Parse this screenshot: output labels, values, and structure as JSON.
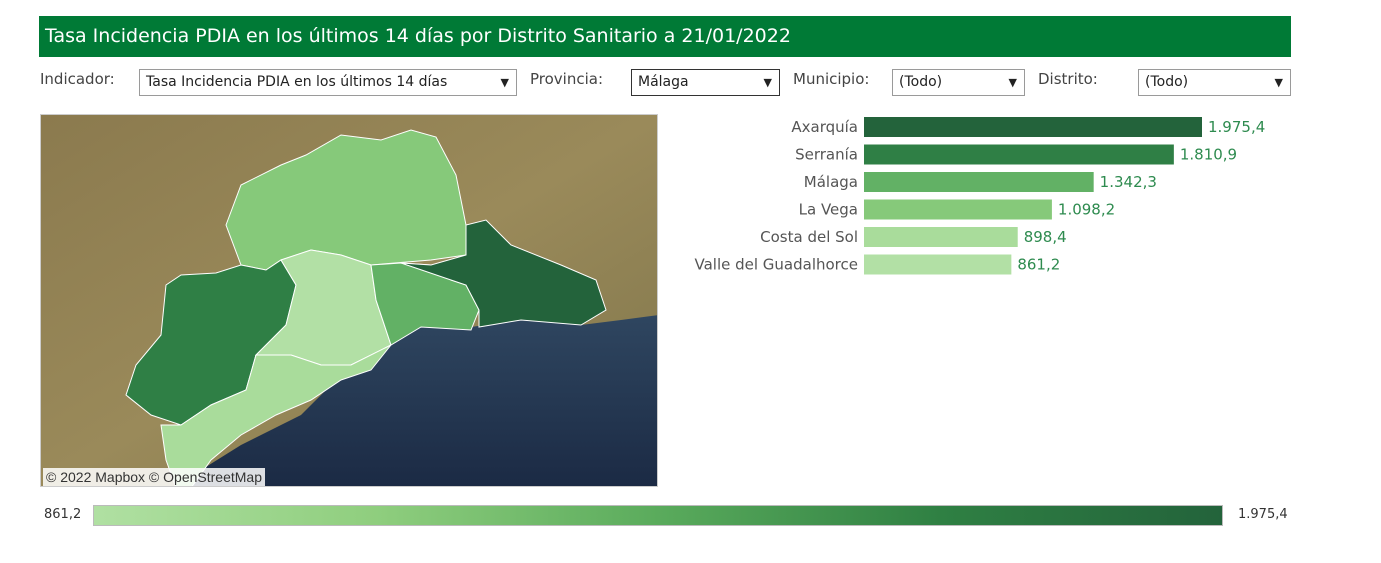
{
  "header": {
    "title": "Tasa Incidencia PDIA en los últimos 14 días por Distrito Sanitario a 21/01/2022"
  },
  "filters": {
    "indicador": {
      "label": "Indicador:",
      "value": "Tasa Incidencia PDIA en los últimos 14 días"
    },
    "provincia": {
      "label": "Provincia:",
      "value": "Málaga"
    },
    "municipio": {
      "label": "Municipio:",
      "value": "(Todo)"
    },
    "distrito": {
      "label": "Distrito:",
      "value": "(Todo)"
    }
  },
  "map": {
    "attribution": "© 2022 Mapbox  © OpenStreetMap"
  },
  "colors": {
    "header_bg": "#007a36",
    "label_text": "#2e8b4f",
    "scale_low": "#b0e0a2",
    "scale_high": "#23633b"
  },
  "chart_data": {
    "type": "bar",
    "orientation": "horizontal",
    "title": "",
    "categories": [
      "Axarquía",
      "Serranía",
      "Málaga",
      "La Vega",
      "Costa del Sol",
      "Valle del Guadalhorce"
    ],
    "values": [
      1975.4,
      1810.9,
      1342.3,
      1098.2,
      898.4,
      861.2
    ],
    "value_labels": [
      "1.975,4",
      "1.810,9",
      "1.342,3",
      "1.098,2",
      "898,4",
      "861,2"
    ],
    "bar_colors": [
      "#23633b",
      "#2f7f45",
      "#62b165",
      "#86c97a",
      "#a9dc9b",
      "#b2e0a5"
    ],
    "xlim": [
      0,
      1975.4
    ]
  },
  "color_legend": {
    "min_label": "861,2",
    "max_label": "1.975,4"
  }
}
